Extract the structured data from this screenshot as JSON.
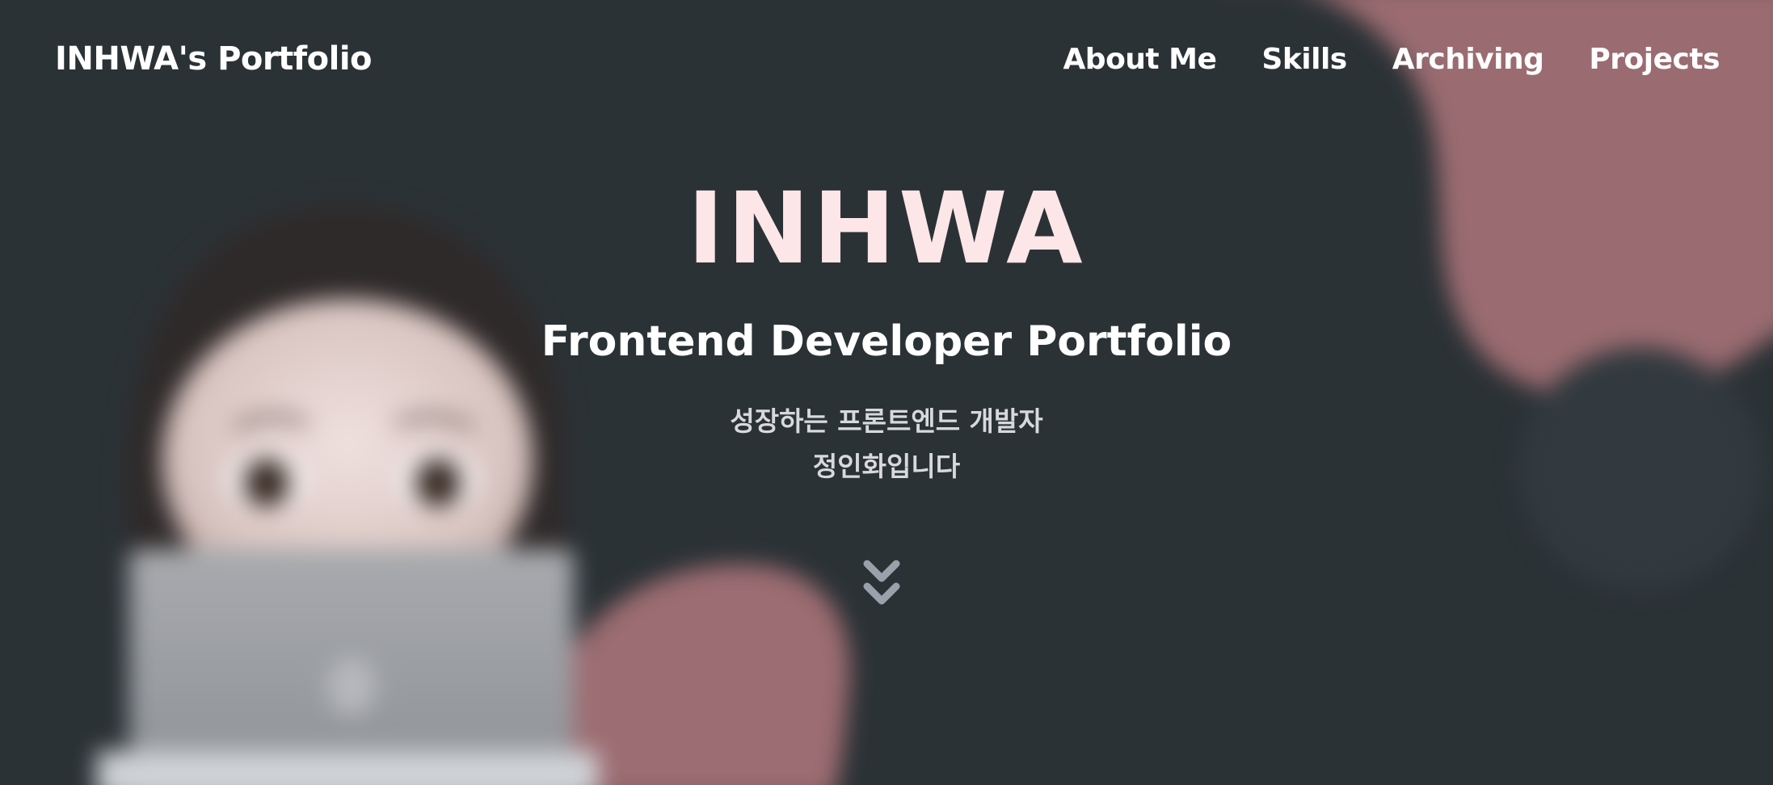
{
  "header": {
    "logo": "INHWA's Portfolio",
    "nav": [
      {
        "label": "About Me"
      },
      {
        "label": "Skills"
      },
      {
        "label": "Archiving"
      },
      {
        "label": "Projects"
      }
    ]
  },
  "hero": {
    "title": "INHWA",
    "subtitle": "Frontend Developer Portfolio",
    "description_line1": "성장하는 프론트엔드 개발자",
    "description_line2": "정인화입니다",
    "scroll_icon": "double-chevron-down-icon"
  },
  "colors": {
    "background": "#2b3236",
    "accent_blob": "#9a6c71",
    "title": "#fde6e8",
    "text": "#ffffff",
    "description": "#d7d9dc",
    "chevron": "#9aa1ab"
  }
}
